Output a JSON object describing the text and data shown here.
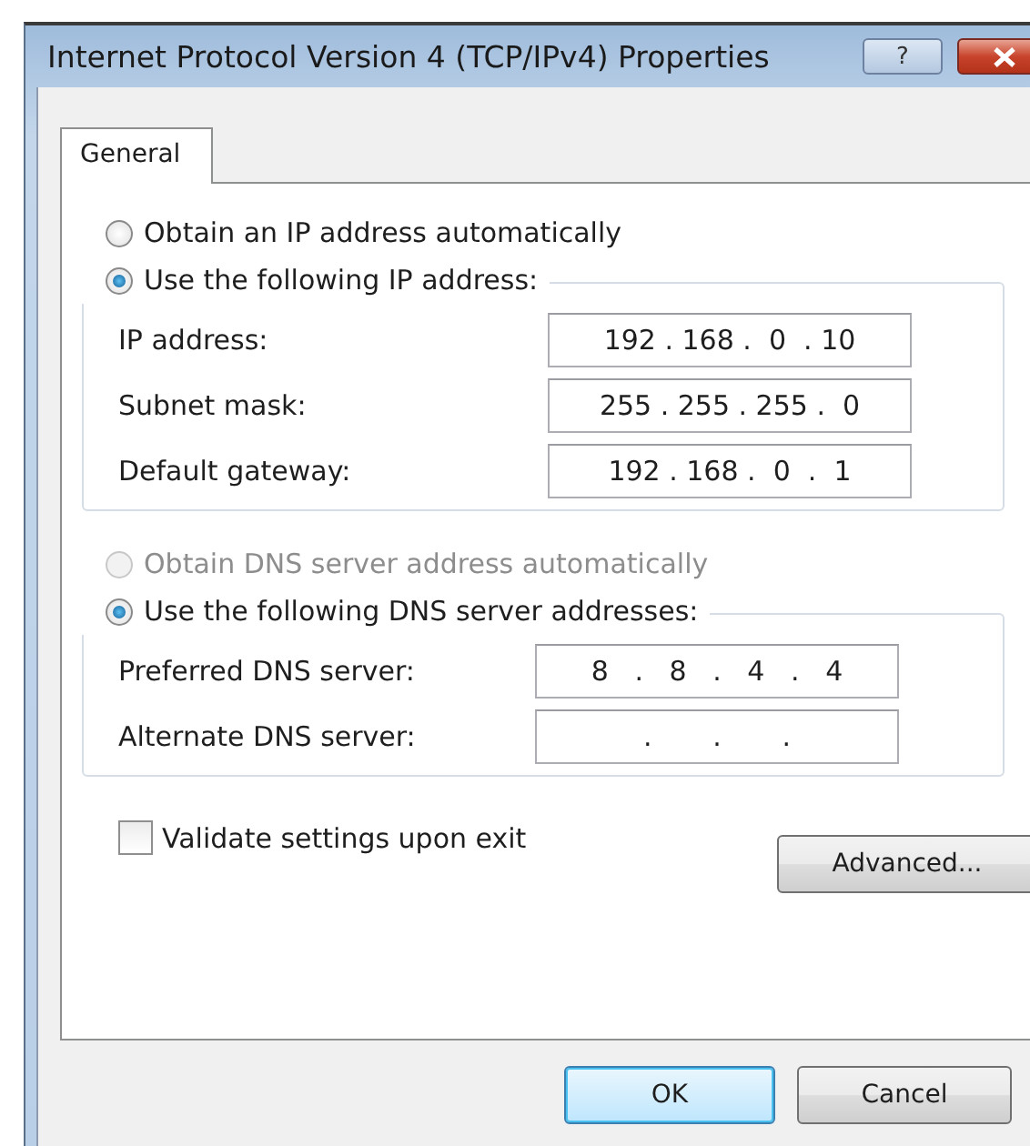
{
  "window": {
    "title": "Internet Protocol Version 4 (TCP/IPv4) Properties",
    "help_button": "?"
  },
  "tabs": [
    {
      "label": "General",
      "selected": true
    }
  ],
  "ip_mode": [
    {
      "label": "Obtain an IP address automatically",
      "selected": false,
      "disabled": false
    },
    {
      "label": "Use the following IP address:",
      "selected": true,
      "disabled": false
    }
  ],
  "ip_fields": [
    {
      "label": "IP address:",
      "value": "192 . 168 .  0  . 10"
    },
    {
      "label": "Subnet mask:",
      "value": "255 . 255 . 255 .  0"
    },
    {
      "label": "Default gateway:",
      "value": "192 . 168 .  0  .  1"
    }
  ],
  "dns_mode": [
    {
      "label": "Obtain DNS server address automatically",
      "selected": false,
      "disabled": true
    },
    {
      "label": "Use the following DNS server addresses:",
      "selected": true,
      "disabled": false
    }
  ],
  "dns_fields": [
    {
      "label": "Preferred DNS server:",
      "value": "8   .   8   .   4   .   4"
    },
    {
      "label": "Alternate DNS server:",
      "value": ".       .       ."
    }
  ],
  "validate": {
    "label": "Validate settings upon exit",
    "checked": false
  },
  "advanced_button": "Advanced...",
  "buttons": [
    {
      "label": "OK",
      "default": true
    },
    {
      "label": "Cancel",
      "default": false
    }
  ]
}
